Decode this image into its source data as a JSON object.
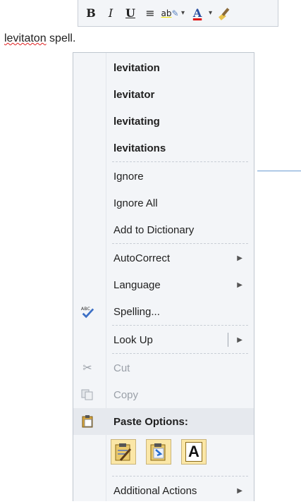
{
  "toolbar": {
    "bold": "B",
    "italic": "I",
    "underline": "U",
    "align_glyph": "≡",
    "highlight_glyph": "ab",
    "font_color_glyph": "A",
    "arrow": "▾"
  },
  "document": {
    "misspelled_word": "levitaton",
    "rest": " spell."
  },
  "menu": {
    "suggestions": [
      "levitation",
      "levitator",
      "levitating",
      "levitations"
    ],
    "ignore": "Ignore",
    "ignore_all": "Ignore All",
    "add_dictionary": "Add to Dictionary",
    "autocorrect": "AutoCorrect",
    "language": "Language",
    "spelling": "Spelling...",
    "look_up": "Look Up",
    "cut": "Cut",
    "copy": "Copy",
    "paste_options": "Paste Options:",
    "paste_text_only": "A",
    "additional_actions": "Additional Actions",
    "submenu_glyph": "▶"
  }
}
